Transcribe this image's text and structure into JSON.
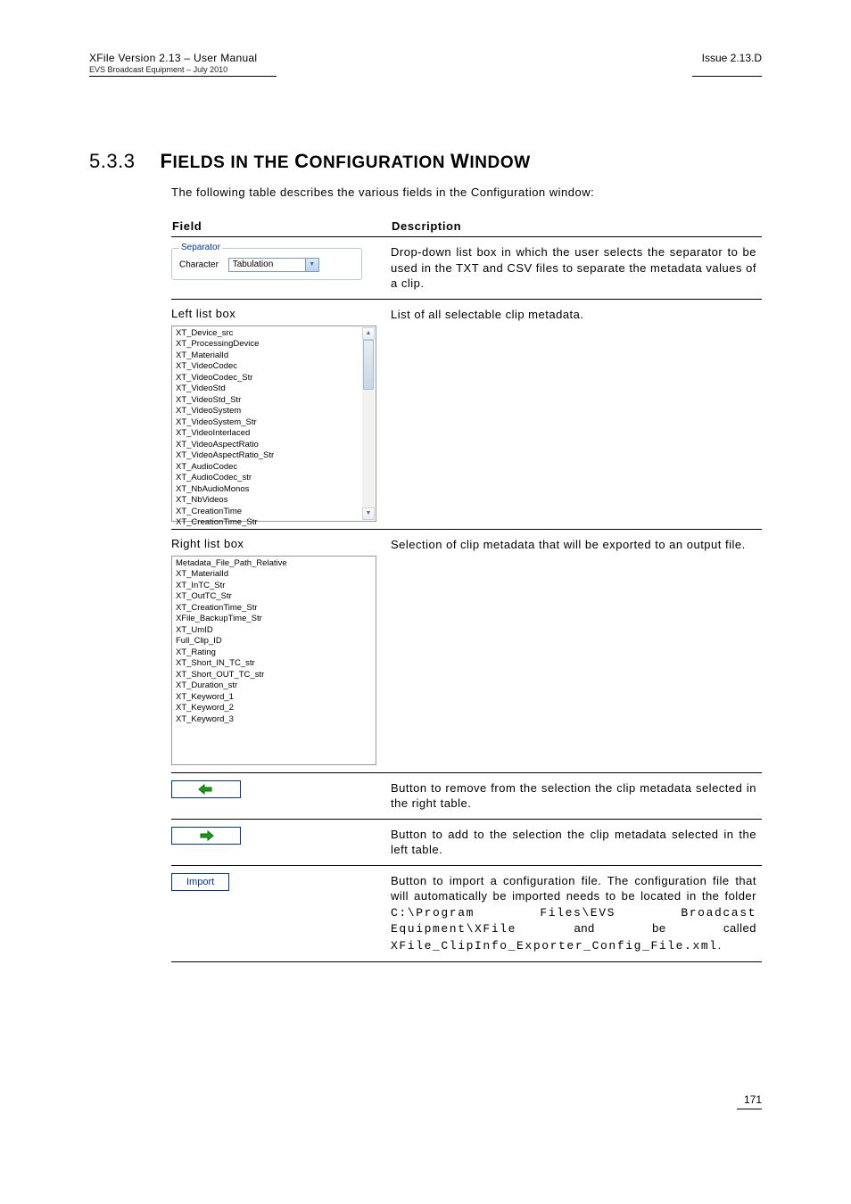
{
  "header": {
    "product_line": "XFile Version 2.13 – User Manual",
    "issuer_line": "EVS Broadcast Equipment – July 2010",
    "issue": "Issue 2.13.D"
  },
  "section": {
    "number": "5.3.3",
    "title_start": "F",
    "title_rest1": "IELDS IN THE ",
    "title_mid": "C",
    "title_rest2": "ONFIGURATION ",
    "title_end": "W",
    "title_rest3": "INDOW"
  },
  "intro": "The following table describes the various fields in the Configuration window:",
  "table": {
    "head_field": "Field",
    "head_desc": "Description"
  },
  "row_separator": {
    "legend": "Separator",
    "label": "Character",
    "value": "Tabulation",
    "desc": "Drop-down list box in which the user selects the separator to be used in the TXT and CSV files to separate the metadata values of a clip."
  },
  "row_left": {
    "label": "Left list box",
    "desc": "List of all selectable clip metadata.",
    "items": [
      "XT_Device_src",
      "XT_ProcessingDevice",
      "XT_MaterialId",
      "XT_VideoCodec",
      "XT_VideoCodec_Str",
      "XT_VideoStd",
      "XT_VideoStd_Str",
      "XT_VideoSystem",
      "XT_VideoSystem_Str",
      "XT_VideoInterlaced",
      "XT_VideoAspectRatio",
      "XT_VideoAspectRatio_Str",
      "XT_AudioCodec",
      "XT_AudioCodec_str",
      "XT_NbAudioMonos",
      "XT_NbVideos",
      "XT_CreationTime",
      "XT_CreationTime_Str"
    ]
  },
  "row_right": {
    "label": "Right list box",
    "desc": "Selection of clip metadata that will be exported to an output file.",
    "items": [
      "Metadata_File_Path_Relative",
      "XT_MaterialId",
      "XT_InTC_Str",
      "XT_OutTC_Str",
      "XT_CreationTime_Str",
      "XFile_BackupTime_Str",
      "XT_UmID",
      "Full_Clip_ID",
      "XT_Rating",
      "XT_Short_IN_TC_str",
      "XT_Short_OUT_TC_str",
      "XT_Duration_str",
      "XT_Keyword_1",
      "XT_Keyword_2",
      "XT_Keyword_3"
    ]
  },
  "row_remove": {
    "desc": "Button to remove from the selection the clip metadata selected in the right table."
  },
  "row_add": {
    "desc": "Button to add to the selection the clip metadata selected in the left table."
  },
  "row_import": {
    "button_label": "Import",
    "desc_1": "Button to import a configuration file. The configuration file that will automatically be imported needs to be located in the folder ",
    "path": "C:\\Program Files\\EVS Broadcast Equipment\\XFile",
    "desc_2": " and be called ",
    "filename": "XFile_ClipInfo_Exporter_Config_File.xml",
    "desc_3": "."
  },
  "page_number": "171"
}
